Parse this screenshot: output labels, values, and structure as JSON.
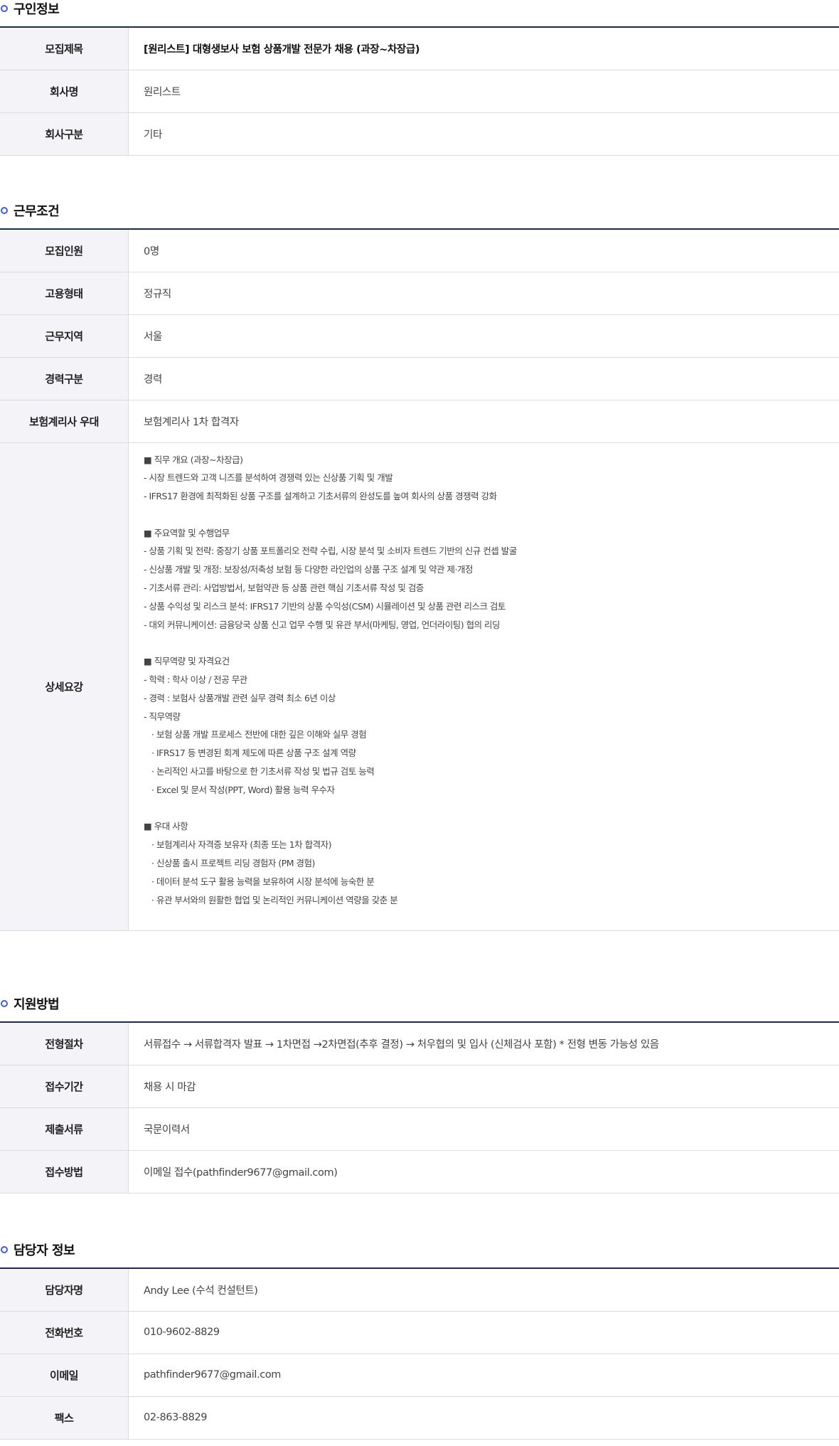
{
  "sections": {
    "recruit": {
      "title": "구인정보",
      "rows": [
        {
          "label": "모집제목",
          "value": "[원리스트] 대형생보사 보험 상품개발 전문가 채용 (과장~차장급)"
        },
        {
          "label": "회사명",
          "value": "원리스트"
        },
        {
          "label": "회사구분",
          "value": "기타"
        }
      ]
    },
    "conditions": {
      "title": "근무조건",
      "rows": [
        {
          "label": "모집인원",
          "value": "0명"
        },
        {
          "label": "고용형태",
          "value": "정규직"
        },
        {
          "label": "근무지역",
          "value": "서울"
        },
        {
          "label": "경력구분",
          "value": "경력"
        },
        {
          "label": "보험계리사 우대",
          "value": "보험계리사 1차 합격자"
        }
      ],
      "detail": {
        "label": "상세요강",
        "lines": [
          "■ 직무 개요 (과장~차장급)",
          "- 시장 트렌드와 고객 니즈를 분석하여 경쟁력 있는 신상품 기획 및 개발",
          "- IFRS17 환경에 최적화된 상품 구조를 설계하고 기초서류의 완성도를 높여 회사의 상품 경쟁력 강화",
          "",
          "■ 주요역할 및 수행업무",
          "- 상품 기획 및 전략: 중장기 상품 포트폴리오 전략 수립, 시장 분석 및 소비자 트렌드 기반의 신규 컨셉 발굴",
          "- 신상품 개발 및 개정: 보장성/저축성 보험 등 다양한 라인업의 상품 구조 설계 및 약관 제·개정",
          "- 기초서류 관리: 사업방법서, 보험약관 등 상품 관련 핵심 기초서류 작성 및 검증",
          "- 상품 수익성 및 리스크 분석: IFRS17 기반의 상품 수익성(CSM) 시뮬레이션 및 상품 관련 리스크 검토",
          "- 대외 커뮤니케이션: 금융당국 상품 신고 업무 수행 및 유관 부서(마케팅, 영업, 언더라이팅) 협의 리딩",
          "",
          "■ 직무역량 및 자격요건",
          "- 학력 : 학사 이상 / 전공 무관",
          "- 경력 : 보험사 상품개발 관련 실무 경력 최소 6년 이상",
          "- 직무역량",
          " · 보험 상품 개발 프로세스 전반에 대한 깊은 이해와 실무 경험",
          " · IFRS17 등 변경된 회계 제도에 따른 상품 구조 설계 역량",
          " · 논리적인 사고를 바탕으로 한 기초서류 작성 및 법규 검토 능력",
          " · Excel 및 문서 작성(PPT, Word) 활용 능력 우수자",
          "",
          "■ 우대 사항",
          " · 보험계리사 자격증 보유자 (최종 또는 1차 합격자)",
          " · 신상품 출시 프로젝트 리딩 경험자 (PM 경험)",
          " · 데이터 분석 도구 활용 능력을 보유하여 시장 분석에 능숙한 분",
          " · 유관 부서와의 원활한 협업 및 논리적인 커뮤니케이션 역량을 갖춘 분"
        ]
      }
    },
    "apply": {
      "title": "지원방법",
      "rows": [
        {
          "label": "전형절차",
          "value": "서류접수 → 서류합격자 발표 → 1차면접 →2차면접(추후 결정) → 처우협의 및 입사 (신체검사 포함) * 전형 변동 가능성 있음"
        },
        {
          "label": "접수기간",
          "value": "채용 시 마감"
        },
        {
          "label": "제출서류",
          "value": "국문이력서"
        },
        {
          "label": "접수방법",
          "value": "이메일 접수(pathfinder9677@gmail.com)"
        }
      ]
    },
    "contact": {
      "title": "담당자 정보",
      "rows": [
        {
          "label": "담당자명",
          "value": "Andy Lee (수석 컨설턴트)"
        },
        {
          "label": "전화번호",
          "value": "010-9602-8829"
        },
        {
          "label": "이메일",
          "value": "pathfinder9677@gmail.com"
        },
        {
          "label": "팩스",
          "value": "02-863-8829"
        }
      ]
    }
  },
  "colors": {
    "accent": "#3e5ed8",
    "table_top_border": "#1b2a4e",
    "label_bg": "#f4f4f8"
  }
}
